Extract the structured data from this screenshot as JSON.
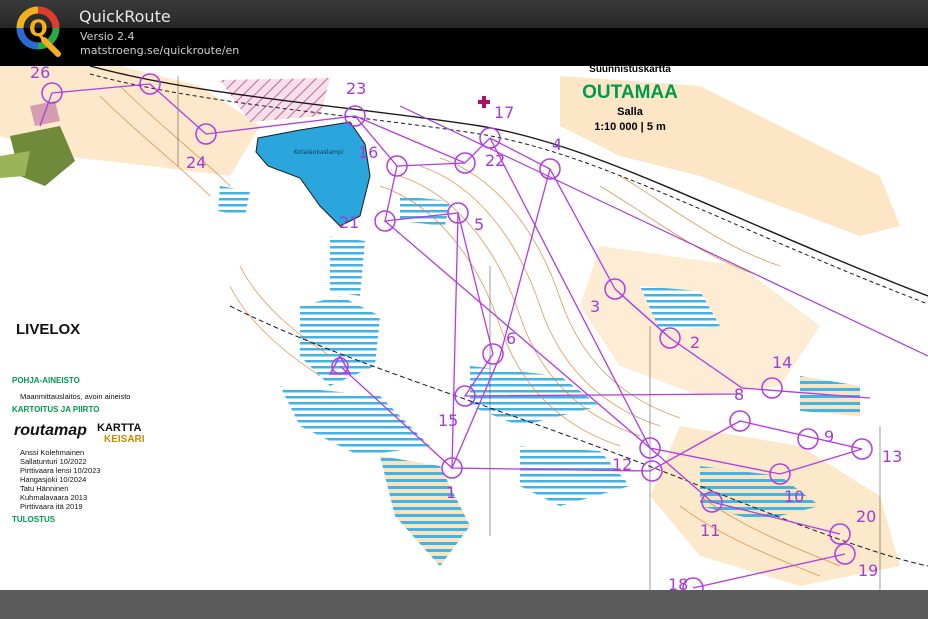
{
  "app": {
    "title": "QuickRoute",
    "version": "Versio 2.4",
    "url": "matstroeng.se/quickroute/en",
    "logo_letter": "Q",
    "logo_colors": [
      "#e23b2e",
      "#f2b01e",
      "#2aa84a",
      "#2a6ad8"
    ]
  },
  "map": {
    "header_top": "Suunnistuskartta",
    "title": "OUTAMAA",
    "area": "Salla",
    "scale": "1:10 000 | 5 m",
    "watermark": "LIVELOX",
    "lake_label": "Kotalankaslampi",
    "legend": {
      "base_head": "POHJA-AINEISTO",
      "base_text": "Maanmittauslaitos, avoin aineisto",
      "mapping_head": "KARTOITUS JA PIIRTO",
      "logo_routamap": "routamap",
      "logo_kartta": "KARTTA",
      "logo_keisari": "KEISARI",
      "credits": [
        "Anssi Kolehmainen",
        "Sallatunturi 10/2022",
        "Pirttivaara lensi 10/2023",
        "Hangasjoki 10/2024",
        "Tatu Hänninen",
        "Kuhmalavaara 2013",
        "Pirttivaara itä 2019"
      ],
      "print_head": "TULOSTUS"
    },
    "colors": {
      "route": "#b23ce0",
      "contour": "#d8873a",
      "open_land": "#f7cf98",
      "water": "#2aa6dc",
      "marsh": "#40b4e6",
      "dark_green": "#6f8a3a",
      "black": "#1a1a1a"
    },
    "controls": [
      {
        "num": "1"
      },
      {
        "num": "2"
      },
      {
        "num": "3"
      },
      {
        "num": "4"
      },
      {
        "num": "5"
      },
      {
        "num": "6"
      },
      {
        "num": "8"
      },
      {
        "num": "9"
      },
      {
        "num": "10"
      },
      {
        "num": "11"
      },
      {
        "num": "12"
      },
      {
        "num": "13"
      },
      {
        "num": "14"
      },
      {
        "num": "15"
      },
      {
        "num": "16"
      },
      {
        "num": "17"
      },
      {
        "num": "18"
      },
      {
        "num": "19"
      },
      {
        "num": "20"
      },
      {
        "num": "21"
      },
      {
        "num": "22"
      },
      {
        "num": "23"
      },
      {
        "num": "24"
      },
      {
        "num": "26"
      }
    ]
  }
}
